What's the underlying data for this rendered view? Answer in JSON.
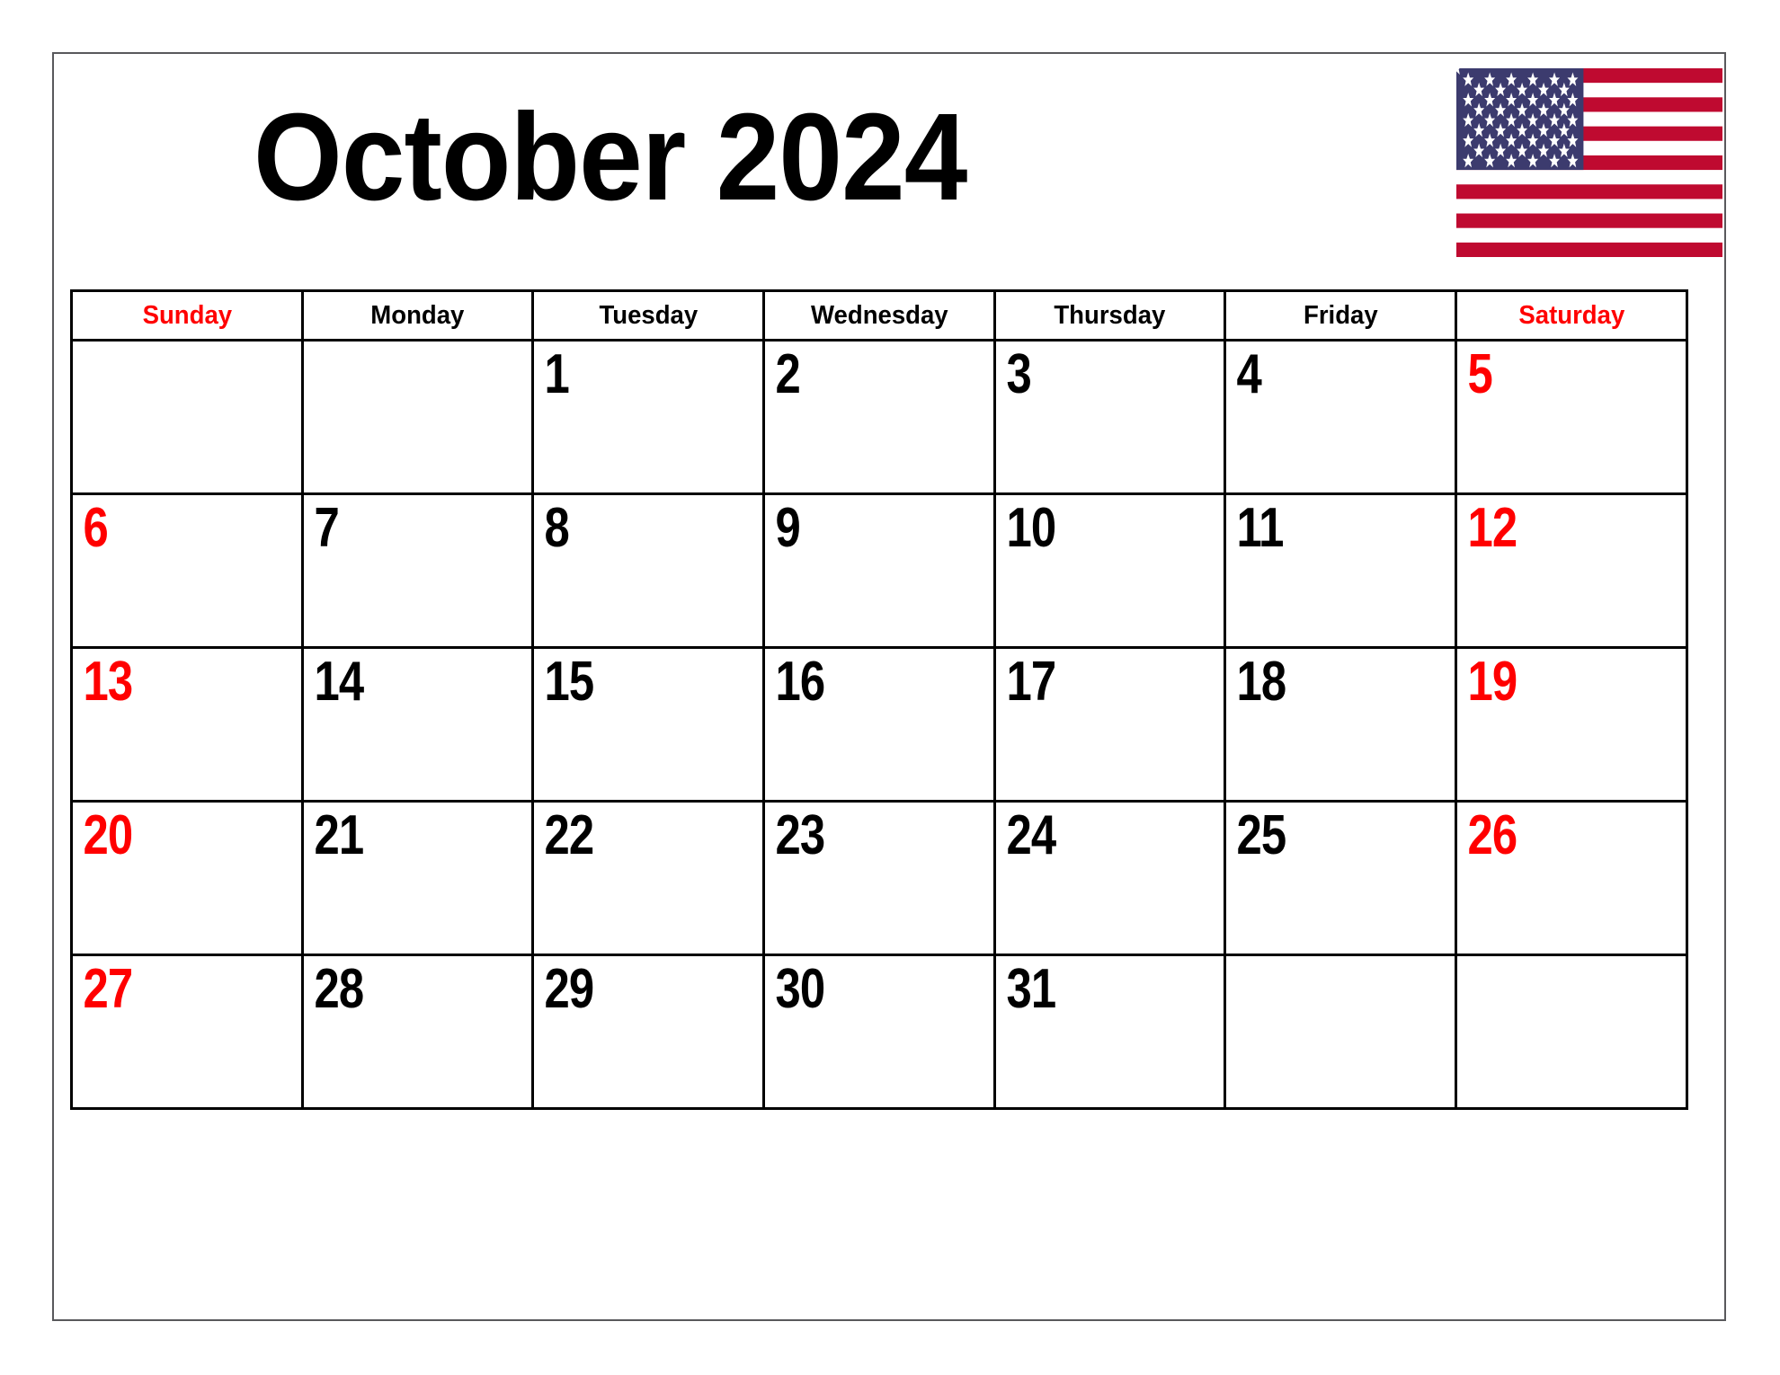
{
  "document": {
    "title": "October 2024",
    "month": "October",
    "year": "2024",
    "type": "monthly-calendar"
  },
  "colors": {
    "weekend_red": "#ff0000",
    "weekday_black": "#000000",
    "grid_line": "#000000",
    "page_border": "#59595c",
    "flag_red": "#bf0a30",
    "flag_blue": "#3c3b6e",
    "flag_white": "#ffffff",
    "background": "#ffffff"
  },
  "flag": {
    "name": "united-states-flag",
    "stripes": 13,
    "stars": 50
  },
  "calendar": {
    "weekday_headers": [
      {
        "label": "Sunday",
        "weekend": true
      },
      {
        "label": "Monday",
        "weekend": false
      },
      {
        "label": "Tuesday",
        "weekend": false
      },
      {
        "label": "Wednesday",
        "weekend": false
      },
      {
        "label": "Thursday",
        "weekend": false
      },
      {
        "label": "Friday",
        "weekend": false
      },
      {
        "label": "Saturday",
        "weekend": true
      }
    ],
    "weeks": [
      [
        {
          "day": "",
          "kind": "empty"
        },
        {
          "day": "",
          "kind": "empty"
        },
        {
          "day": "1",
          "kind": "weekday"
        },
        {
          "day": "2",
          "kind": "weekday"
        },
        {
          "day": "3",
          "kind": "weekday"
        },
        {
          "day": "4",
          "kind": "weekday"
        },
        {
          "day": "5",
          "kind": "saturday"
        }
      ],
      [
        {
          "day": "6",
          "kind": "sunday"
        },
        {
          "day": "7",
          "kind": "weekday"
        },
        {
          "day": "8",
          "kind": "weekday"
        },
        {
          "day": "9",
          "kind": "weekday"
        },
        {
          "day": "10",
          "kind": "weekday"
        },
        {
          "day": "11",
          "kind": "weekday"
        },
        {
          "day": "12",
          "kind": "saturday"
        }
      ],
      [
        {
          "day": "13",
          "kind": "sunday"
        },
        {
          "day": "14",
          "kind": "weekday"
        },
        {
          "day": "15",
          "kind": "weekday"
        },
        {
          "day": "16",
          "kind": "weekday"
        },
        {
          "day": "17",
          "kind": "weekday"
        },
        {
          "day": "18",
          "kind": "weekday"
        },
        {
          "day": "19",
          "kind": "saturday"
        }
      ],
      [
        {
          "day": "20",
          "kind": "sunday"
        },
        {
          "day": "21",
          "kind": "weekday"
        },
        {
          "day": "22",
          "kind": "weekday"
        },
        {
          "day": "23",
          "kind": "weekday"
        },
        {
          "day": "24",
          "kind": "weekday"
        },
        {
          "day": "25",
          "kind": "weekday"
        },
        {
          "day": "26",
          "kind": "saturday"
        }
      ],
      [
        {
          "day": "27",
          "kind": "sunday"
        },
        {
          "day": "28",
          "kind": "weekday"
        },
        {
          "day": "29",
          "kind": "weekday"
        },
        {
          "day": "30",
          "kind": "weekday"
        },
        {
          "day": "31",
          "kind": "weekday"
        },
        {
          "day": "",
          "kind": "empty"
        },
        {
          "day": "",
          "kind": "empty"
        }
      ]
    ]
  }
}
